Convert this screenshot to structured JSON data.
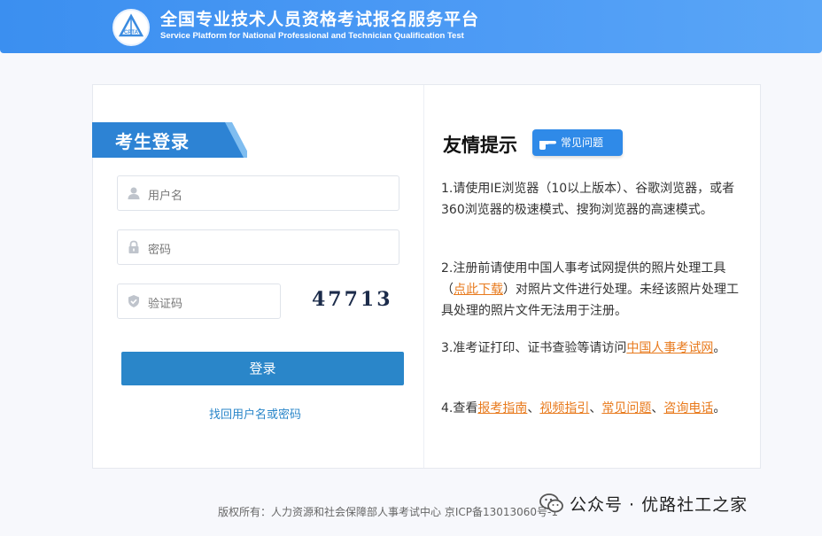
{
  "header": {
    "title_cn": "全国专业技术人员资格考试报名服务平台",
    "title_en": "Service Platform for National Professional and Technician Qualification Test",
    "logo_text": "CPTA"
  },
  "login": {
    "tab_label": "考生登录",
    "username_placeholder": "用户名",
    "password_placeholder": "密码",
    "captcha_placeholder": "验证码",
    "captcha_text": "47713",
    "login_button": "登录",
    "recover_link": "找回用户名或密码"
  },
  "tips": {
    "title": "友情提示",
    "faq_badge": "常见问题",
    "tip1": "1.请使用IE浏览器（10以上版本）、谷歌浏览器，或者360浏览器的极速模式、搜狗浏览器的高速模式。",
    "tip2_before": "2.注册前请使用中国人事考试网提供的照片处理工具（",
    "tip2_link": "点此下载",
    "tip2_after": "）对照片文件进行处理。未经该照片处理工具处理的照片文件无法用于注册。",
    "tip3_before": "3.准考证打印、证书查验等请访问",
    "tip3_link": "中国人事考试网",
    "tip3_after": "。",
    "tip4_before": "4.查看",
    "tip4_link1": "报考指南",
    "tip4_sep1": "、",
    "tip4_link2": "视频指引",
    "tip4_sep2": "、",
    "tip4_link3": "常见问题",
    "tip4_sep3": "、",
    "tip4_link4": "咨询电话",
    "tip4_after": "。"
  },
  "footer": {
    "copyright": "版权所有：人力资源和社会保障部人事考试中心 京ICP备13013060号-1"
  },
  "watermark": {
    "text": "公众号 · 优路社工之家"
  },
  "colors": {
    "header_blue": "#3b8ff0",
    "button_blue": "#2a86c9",
    "link_orange": "#e87a1d"
  }
}
